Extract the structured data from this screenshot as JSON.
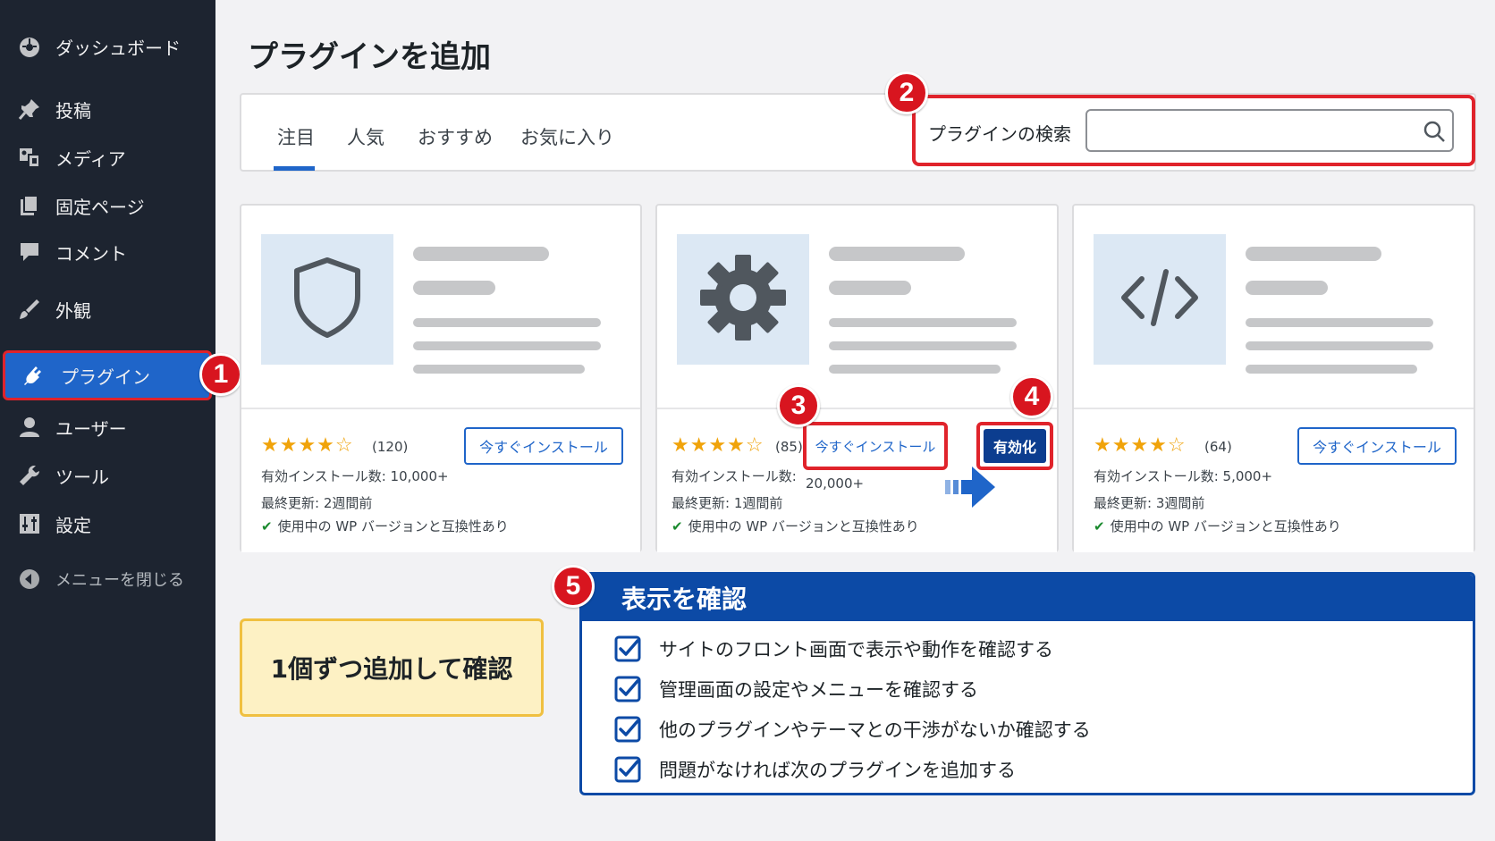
{
  "sidebar": {
    "items": [
      {
        "label": "ダッシュボード",
        "icon": "dashboard-icon"
      },
      {
        "label": "投稿",
        "icon": "pin-icon"
      },
      {
        "label": "メディア",
        "icon": "media-icon"
      },
      {
        "label": "固定ページ",
        "icon": "page-icon"
      },
      {
        "label": "コメント",
        "icon": "comment-icon"
      },
      {
        "label": "外観",
        "icon": "brush-icon"
      },
      {
        "label": "プラグイン",
        "icon": "plugin-icon",
        "active": true
      },
      {
        "label": "ユーザー",
        "icon": "user-icon"
      },
      {
        "label": "ツール",
        "icon": "wrench-icon"
      },
      {
        "label": "設定",
        "icon": "settings-icon"
      },
      {
        "label": "メニューを閉じる",
        "icon": "collapse-icon"
      }
    ]
  },
  "badges": {
    "b1": "1",
    "b2": "2",
    "b3": "3",
    "b4": "4",
    "b5": "5"
  },
  "page": {
    "title": "プラグインを追加"
  },
  "tabs": [
    {
      "label": "注目",
      "active": true
    },
    {
      "label": "人気"
    },
    {
      "label": "おすすめ"
    },
    {
      "label": "お気に入り"
    }
  ],
  "search": {
    "label": "プラグインの検索",
    "value": ""
  },
  "cards": [
    {
      "icon": "shield-icon",
      "rating": 4.5,
      "rating_count": "(120)",
      "installs": "有効インストール数: 10,000+",
      "updated": "最終更新: 2週間前",
      "compat": "使用中の WP バージョンと互換性あり",
      "install_label": "今すぐインストール"
    },
    {
      "icon": "gear-icon",
      "rating": 4.5,
      "rating_count": "(85)",
      "installs_label": "有効インストール数:",
      "installs_value": "20,000+",
      "updated": "最終更新: 1週間前",
      "compat": "使用中の WP バージョンと互換性あり",
      "install_label": "今すぐインストール",
      "activate_label": "有効化"
    },
    {
      "icon": "code-icon",
      "rating": 4.5,
      "rating_count": "(64)",
      "installs": "有効インストール数: 5,000+",
      "updated": "最終更新: 3週間前",
      "compat": "使用中の WP バージョンと互換性あり",
      "install_label": "今すぐインストール"
    }
  ],
  "note": {
    "text": "1個ずつ追加して確認"
  },
  "checklist": {
    "title": "表示を確認",
    "items": [
      "サイトのフロント画面で表示や動作を確認する",
      "管理画面の設定やメニューを確認する",
      "他のプラグインやテーマとの干渉がないか確認する",
      "問題がなければ次のプラグインを追加する"
    ]
  },
  "colors": {
    "sidebar_bg": "#1d2430",
    "accent": "#1f65c9",
    "highlight": "#e0232b",
    "panel_blue": "#0c4aa6"
  }
}
